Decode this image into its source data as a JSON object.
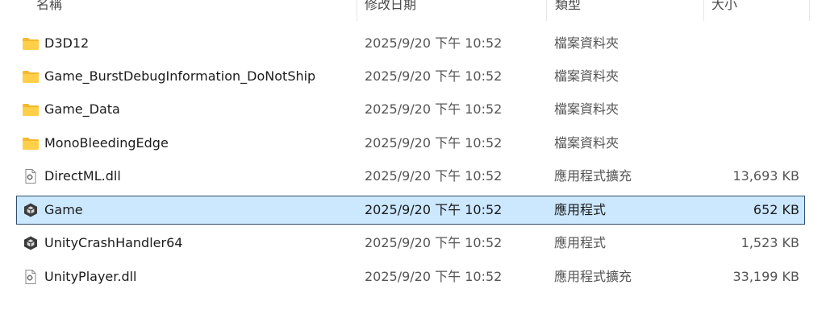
{
  "columns": {
    "name": "名稱",
    "date": "修改日期",
    "type": "類型",
    "size": "大小"
  },
  "files": [
    {
      "name": "D3D12",
      "date": "2025/9/20 下午 10:52",
      "type": "檔案資料夾",
      "size": "",
      "icon": "folder-icon",
      "selected": false
    },
    {
      "name": "Game_BurstDebugInformation_DoNotShip",
      "date": "2025/9/20 下午 10:52",
      "type": "檔案資料夾",
      "size": "",
      "icon": "folder-icon",
      "selected": false
    },
    {
      "name": "Game_Data",
      "date": "2025/9/20 下午 10:52",
      "type": "檔案資料夾",
      "size": "",
      "icon": "folder-icon",
      "selected": false
    },
    {
      "name": "MonoBleedingEdge",
      "date": "2025/9/20 下午 10:52",
      "type": "檔案資料夾",
      "size": "",
      "icon": "folder-icon",
      "selected": false
    },
    {
      "name": "DirectML.dll",
      "date": "2025/9/20 下午 10:52",
      "type": "應用程式擴充",
      "size": "13,693 KB",
      "icon": "dll-file-icon",
      "selected": false
    },
    {
      "name": "Game",
      "date": "2025/9/20 下午 10:52",
      "type": "應用程式",
      "size": "652 KB",
      "icon": "unity-app-icon",
      "selected": true
    },
    {
      "name": "UnityCrashHandler64",
      "date": "2025/9/20 下午 10:52",
      "type": "應用程式",
      "size": "1,523 KB",
      "icon": "unity-app-icon",
      "selected": false
    },
    {
      "name": "UnityPlayer.dll",
      "date": "2025/9/20 下午 10:52",
      "type": "應用程式擴充",
      "size": "33,199 KB",
      "icon": "dll-file-icon",
      "selected": false
    }
  ],
  "colors": {
    "selection_bg": "#cce8ff",
    "selection_border": "#2f4f6f",
    "folder": "#ffc83d"
  }
}
